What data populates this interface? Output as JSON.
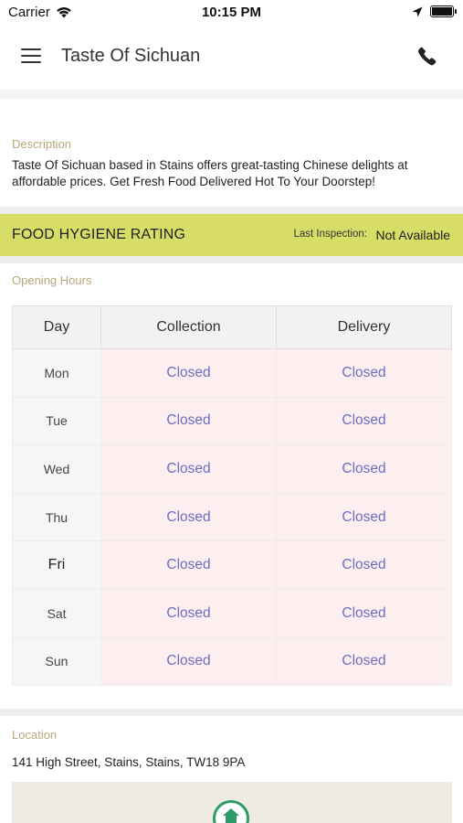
{
  "status_bar": {
    "carrier": "Carrier",
    "time": "10:15 PM"
  },
  "header": {
    "title": "Taste Of Sichuan",
    "menu_icon": "hamburger-menu-icon",
    "phone_icon": "phone-icon"
  },
  "description": {
    "label": "Description",
    "text": "Taste Of Sichuan based in Stains offers great-tasting Chinese delights at affordable prices. Get Fresh Food Delivered Hot To Your Doorstep!"
  },
  "hygiene": {
    "title": "FOOD HYGIENE RATING",
    "last_inspection_label": "Last Inspection:",
    "last_inspection_value": "Not Available",
    "color": "#d8dd67"
  },
  "opening_hours": {
    "label": "Opening Hours",
    "columns": [
      "Day",
      "Collection",
      "Delivery"
    ],
    "rows": [
      {
        "day": "Mon",
        "collection": "Closed",
        "delivery": "Closed"
      },
      {
        "day": "Tue",
        "collection": "Closed",
        "delivery": "Closed"
      },
      {
        "day": "Wed",
        "collection": "Closed",
        "delivery": "Closed"
      },
      {
        "day": "Thu",
        "collection": "Closed",
        "delivery": "Closed"
      },
      {
        "day": "Fri",
        "collection": "Closed",
        "delivery": "Closed"
      },
      {
        "day": "Sat",
        "collection": "Closed",
        "delivery": "Closed"
      },
      {
        "day": "Sun",
        "collection": "Closed",
        "delivery": "Closed"
      }
    ]
  },
  "location": {
    "label": "Location",
    "address": "141 High Street, Stains, Stains, TW18 9PA"
  }
}
